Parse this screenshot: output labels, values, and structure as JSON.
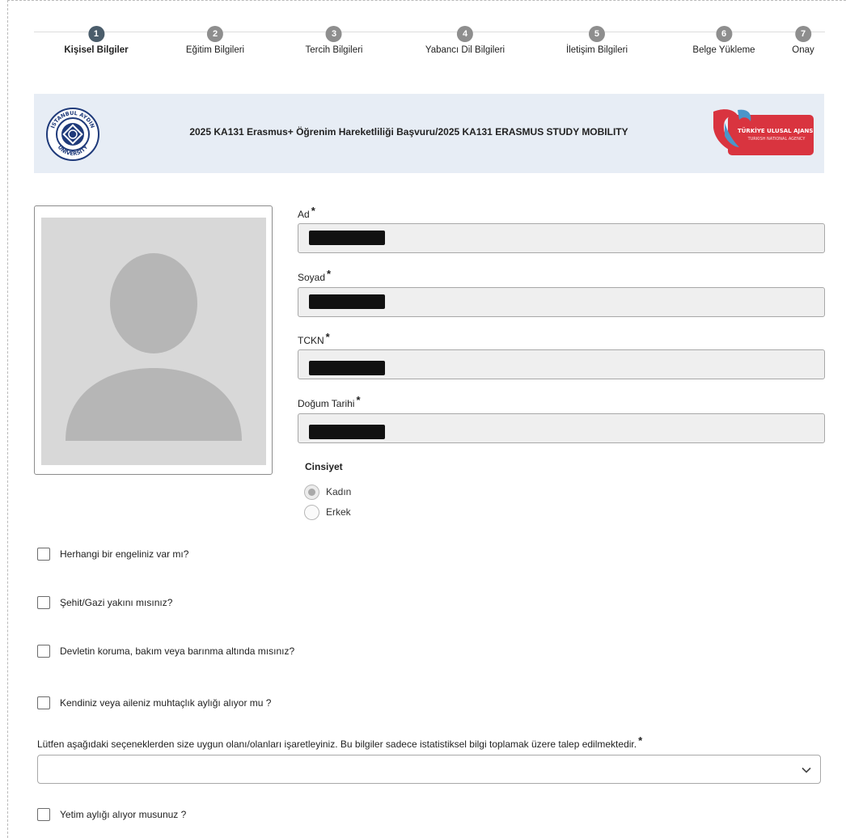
{
  "steps": [
    {
      "num": "1",
      "label": "Kişisel Bilgiler",
      "active": true
    },
    {
      "num": "2",
      "label": "Eğitim Bilgileri"
    },
    {
      "num": "3",
      "label": "Tercih Bilgileri"
    },
    {
      "num": "4",
      "label": "Yabancı Dil Bilgileri"
    },
    {
      "num": "5",
      "label": "İletişim Bilgileri"
    },
    {
      "num": "6",
      "label": "Belge Yükleme"
    },
    {
      "num": "7",
      "label": "Onay"
    }
  ],
  "banner": {
    "title": "2025 KA131 Erasmus+ Öğrenim Hareketliliği Başvuru/2025 KA131 ERASMUS STUDY MOBILITY",
    "uni_logo_text_top": "İSTANBUL AYDIN",
    "uni_logo_text_bottom": "UNIVERSITY",
    "agency_line1": "TÜRKİYE ULUSAL AJANSI",
    "agency_line2": "TURKISH NATIONAL AGENCY"
  },
  "form": {
    "ad_label": "Ad",
    "soyad_label": "Soyad",
    "tckn_label": "TCKN",
    "dogum_label": "Doğum Tarihi",
    "required_mark": "*",
    "gender_title": "Cinsiyet",
    "gender_options": [
      "Kadın",
      "Erkek"
    ],
    "gender_selected": "Kadın"
  },
  "checks": [
    "Herhangi bir engeliniz var mı?",
    "Şehit/Gazi yakını mısınız?",
    "Devletin koruma, bakım veya barınma altında mısınız?",
    "Kendiniz veya aileniz muhtaçlık aylığı alıyor mu ?"
  ],
  "select": {
    "label": "Lütfen aşağıdaki seçeneklerden size uygun olanı/olanları işaretleyiniz. Bu bilgiler sadece istatistiksel bilgi toplamak üzere talep edilmektedir.",
    "value": ""
  },
  "last_check": "Yetim aylığı alıyor musunuz ?",
  "colors": {
    "banner_bg": "#e7edf5",
    "step_active": "#4b5d6b",
    "step_inactive": "#8e8e8e",
    "agency_red": "#d9343f"
  }
}
